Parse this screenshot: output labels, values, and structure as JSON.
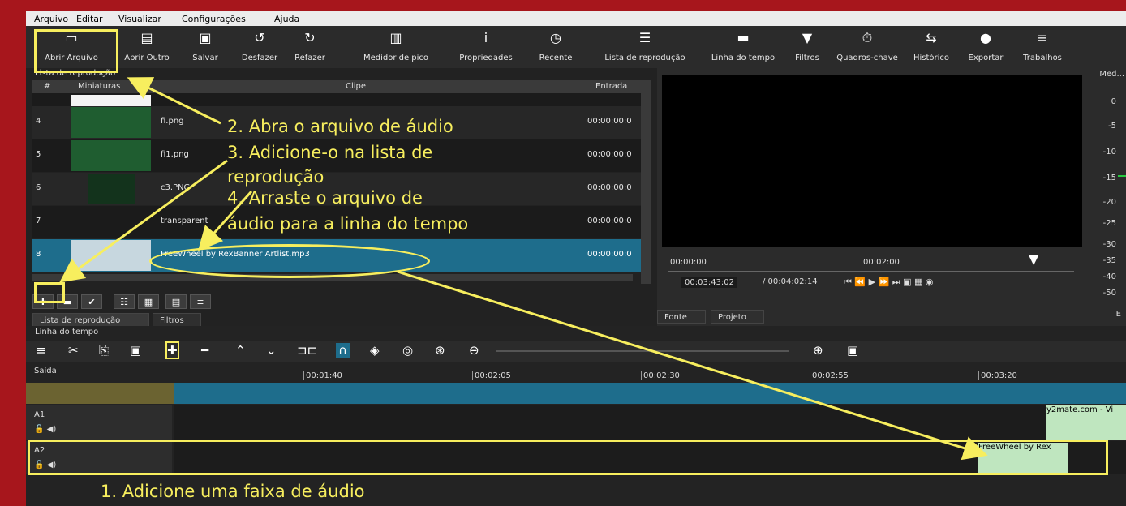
{
  "menu": [
    "Arquivo",
    "Editar",
    "Visualizar",
    "Configurações",
    "Ajuda"
  ],
  "toolbar": [
    "Abrir Arquivo",
    "Abrir Outro",
    "Salvar",
    "Desfazer",
    "Refazer",
    "Medidor de pico",
    "Propriedades",
    "Recente",
    "Lista de reprodução",
    "Linha do tempo",
    "Filtros",
    "Quadros-chave",
    "Histórico",
    "Exportar",
    "Trabalhos"
  ],
  "playlist": {
    "title": "Lista de reprodução",
    "columns": [
      "#",
      "Miniaturas",
      "Clipe",
      "Entrada"
    ],
    "rows": [
      {
        "num": "4",
        "clip": "fi.png",
        "in": "00:00:00:0"
      },
      {
        "num": "5",
        "clip": "fi1.png",
        "in": "00:00:00:0"
      },
      {
        "num": "6",
        "clip": "c3.PNG",
        "in": "00:00:00:0"
      },
      {
        "num": "7",
        "clip": "transparent",
        "in": "00:00:00:0"
      },
      {
        "num": "8",
        "clip": "FreeWheel by RexBanner Artlist.mp3",
        "in": "00:00:00:0"
      }
    ],
    "tabs": [
      "Lista de reprodução",
      "Filtros"
    ]
  },
  "player": {
    "ruler": [
      "00:00:00",
      "00:02:00"
    ],
    "position": "00:03:43:02",
    "duration": "/ 00:04:02:14",
    "tabs": [
      "Fonte",
      "Projeto"
    ],
    "meter_title": "Med...",
    "meter_ticks": [
      "0",
      "-5",
      "-10",
      "-15",
      "-20",
      "-25",
      "-30",
      "-35",
      "-40",
      "-50"
    ],
    "meter_foot": "E"
  },
  "timeline": {
    "title": "Linha do tempo",
    "output": "Saída",
    "ticks": [
      "00:01:40",
      "00:02:05",
      "00:02:30",
      "00:02:55",
      "00:03:20"
    ],
    "tracks": [
      "A1",
      "A2"
    ],
    "clip_a1": "y2mate.com - Vi",
    "clip_a2": "FreeWheel by Rex"
  },
  "annotations": {
    "step1": "1. Adicione uma faixa de áudio",
    "step2": "2. Abra o arquivo de áudio",
    "step3a": "3. Adicione-o na lista de",
    "step3b": "reprodução",
    "step4a": "4. Arraste o arquivo de",
    "step4b": "áudio para a linha do tempo"
  },
  "colors": {
    "annotation": "#f7ee5e",
    "frame": "#a7161c",
    "accent": "#1e6d8c",
    "clip": "#bfe6bf"
  }
}
